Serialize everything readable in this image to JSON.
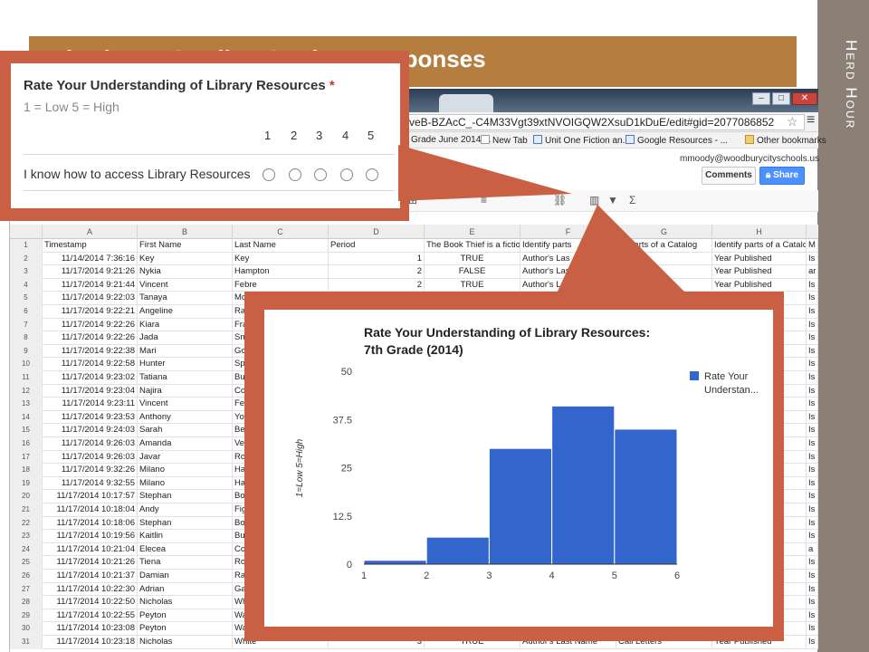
{
  "slide": {
    "title": "Viewing & Grading Student Responses",
    "side_title": "Herd Hour",
    "accent_color": "#b57e3f",
    "callout_color": "#c95f43",
    "strip_color": "#8b7f76"
  },
  "browser": {
    "url": "veB-BZAcC_-C4M33Vgt39xtNVOIGQW2XsuD1kDuE/edit#gid=2077086852",
    "bookmarks": [
      "Grade June 2014 ...",
      "New Tab",
      "Unit One Fiction an...",
      "Google Resources - ...",
      "Other bookmarks"
    ],
    "account": "mmoody@woodburycityschools.us",
    "comments_label": "Comments",
    "share_label": "Share"
  },
  "sheet": {
    "columns": [
      "A",
      "B",
      "C",
      "D",
      "E",
      "F",
      "G",
      "H"
    ],
    "header": [
      "Timestamp",
      "First Name",
      "Last Name",
      "Period",
      "The Book Thief is a fictio",
      "Identify parts",
      "ify parts of a Catalog",
      "Identify parts of a Catalog",
      "M"
    ],
    "rows": [
      [
        "2",
        "11/14/2014 7:36:16",
        "Key",
        "Key",
        "1",
        "TRUE",
        "Author's Las",
        "",
        "Year Published",
        "Is"
      ],
      [
        "3",
        "11/17/2014 9:21:26",
        "Nykia",
        "Hampton",
        "2",
        "FALSE",
        "Author's Las",
        "",
        "Year Published",
        "ar"
      ],
      [
        "4",
        "11/17/2014 9:21:44",
        "Vincent",
        "Febre",
        "2",
        "TRUE",
        "Author's L",
        "",
        "Year Published",
        "Is"
      ],
      [
        "5",
        "11/17/2014 9:22:03",
        "Tanaya",
        "Mc",
        "",
        "",
        "",
        "",
        "",
        "Is"
      ],
      [
        "6",
        "11/17/2014 9:22:21",
        "Angeline",
        "Ra",
        "",
        "",
        "",
        "",
        "",
        "Is"
      ],
      [
        "7",
        "11/17/2014 9:22:26",
        "Kiara",
        "Fra",
        "",
        "",
        "",
        "",
        "",
        "Is"
      ],
      [
        "8",
        "11/17/2014 9:22:26",
        "Jada",
        "Sm",
        "",
        "",
        "",
        "",
        "",
        "Is"
      ],
      [
        "9",
        "11/17/2014 9:22:38",
        "Mari",
        "Go",
        "",
        "",
        "",
        "",
        "",
        "Is"
      ],
      [
        "10",
        "11/17/2014 9:22:58",
        "Hunter",
        "Sp",
        "",
        "",
        "",
        "",
        "",
        "Is"
      ],
      [
        "11",
        "11/17/2014 9:23:02",
        "Tatiana",
        "Bu",
        "",
        "",
        "",
        "",
        "",
        "Is"
      ],
      [
        "12",
        "11/17/2014 9:23:04",
        "Najira",
        "Co",
        "",
        "",
        "",
        "",
        "",
        "Is"
      ],
      [
        "13",
        "11/17/2014 9:23:11",
        "Vincent",
        "Fe",
        "",
        "",
        "",
        "",
        "",
        "Is"
      ],
      [
        "14",
        "11/17/2014 9:23:53",
        "Anthony",
        "Yo",
        "",
        "",
        "",
        "",
        "",
        "Is"
      ],
      [
        "15",
        "11/17/2014 9:24:03",
        "Sarah",
        "Be",
        "",
        "",
        "",
        "",
        "",
        "Is"
      ],
      [
        "16",
        "11/17/2014 9:26:03",
        "Amanda",
        "Ve",
        "",
        "",
        "",
        "",
        "",
        "Is"
      ],
      [
        "17",
        "11/17/2014 9:26:03",
        "Javar",
        "Ro",
        "",
        "",
        "",
        "",
        "",
        "Is"
      ],
      [
        "18",
        "11/17/2014 9:32:26",
        "Milano",
        "Ha",
        "",
        "",
        "",
        "",
        "",
        "Is"
      ],
      [
        "19",
        "11/17/2014 9:32:55",
        "Milano",
        "Ha",
        "",
        "",
        "",
        "",
        "",
        "Is"
      ],
      [
        "20",
        "11/17/2014 10:17:57",
        "Stephan",
        "Bo",
        "",
        "",
        "",
        "",
        "",
        "Is"
      ],
      [
        "21",
        "11/17/2014 10:18:04",
        "Andy",
        "Fig",
        "",
        "",
        "",
        "",
        "",
        "Is"
      ],
      [
        "22",
        "11/17/2014 10:18:06",
        "Stephan",
        "Bo",
        "",
        "",
        "",
        "",
        "",
        "Is"
      ],
      [
        "23",
        "11/17/2014 10:19:56",
        "Kaitlin",
        "Bu",
        "",
        "",
        "",
        "",
        "",
        "Is"
      ],
      [
        "24",
        "11/17/2014 10:21:04",
        "Elecea",
        "Co",
        "",
        "",
        "",
        "",
        "",
        "a"
      ],
      [
        "25",
        "11/17/2014 10:21:26",
        "Tiena",
        "Ro",
        "",
        "",
        "",
        "",
        "",
        "Is"
      ],
      [
        "26",
        "11/17/2014 10:21:37",
        "Damian",
        "Ra",
        "",
        "",
        "",
        "",
        "",
        "Is"
      ],
      [
        "27",
        "11/17/2014 10:22:30",
        "Adrian",
        "Ga",
        "",
        "",
        "",
        "",
        "",
        "Is"
      ],
      [
        "28",
        "11/17/2014 10:22:50",
        "Nicholas",
        "Wh",
        "",
        "",
        "",
        "",
        "",
        "Is"
      ],
      [
        "29",
        "11/17/2014 10:22:55",
        "Peyton",
        "Wa",
        "",
        "",
        "",
        "",
        "",
        "Is"
      ],
      [
        "30",
        "11/17/2014 10:23:08",
        "Peyton",
        "Wa",
        "",
        "",
        "",
        "",
        "",
        "Is"
      ],
      [
        "31",
        "11/17/2014 10:23:18",
        "Nicholas",
        "White",
        "3",
        "TRUE",
        "Author's Last Name",
        "Call Letters",
        "Year Published",
        "Is"
      ]
    ]
  },
  "form": {
    "question": "Rate Your Understanding of Library Resources",
    "required_mark": "*",
    "help": "1 = Low 5 = High",
    "scale": [
      "1",
      "2",
      "3",
      "4",
      "5"
    ],
    "row_label": "I know how to access Library Resources"
  },
  "chart_data": {
    "type": "bar",
    "title": "Rate Your Understanding of Library Resources:",
    "subtitle": "7th Grade (2014)",
    "ylabel": "1=Low 5=High",
    "xlabel": "",
    "x_ticks": [
      "1",
      "2",
      "3",
      "4",
      "5",
      "6"
    ],
    "y_ticks": [
      "0",
      "12.5",
      "25",
      "37.5",
      "50"
    ],
    "ylim": [
      0,
      50
    ],
    "xlim": [
      1,
      6
    ],
    "bins": [
      {
        "from": 1,
        "to": 2,
        "value": 1
      },
      {
        "from": 2,
        "to": 3,
        "value": 7
      },
      {
        "from": 3,
        "to": 4,
        "value": 30
      },
      {
        "from": 4,
        "to": 5,
        "value": 41
      },
      {
        "from": 5,
        "to": 6,
        "value": 35
      }
    ],
    "series": [
      {
        "name": "Rate Your Understan...",
        "color": "#3366cc"
      }
    ],
    "legend": "right",
    "grid": false
  }
}
